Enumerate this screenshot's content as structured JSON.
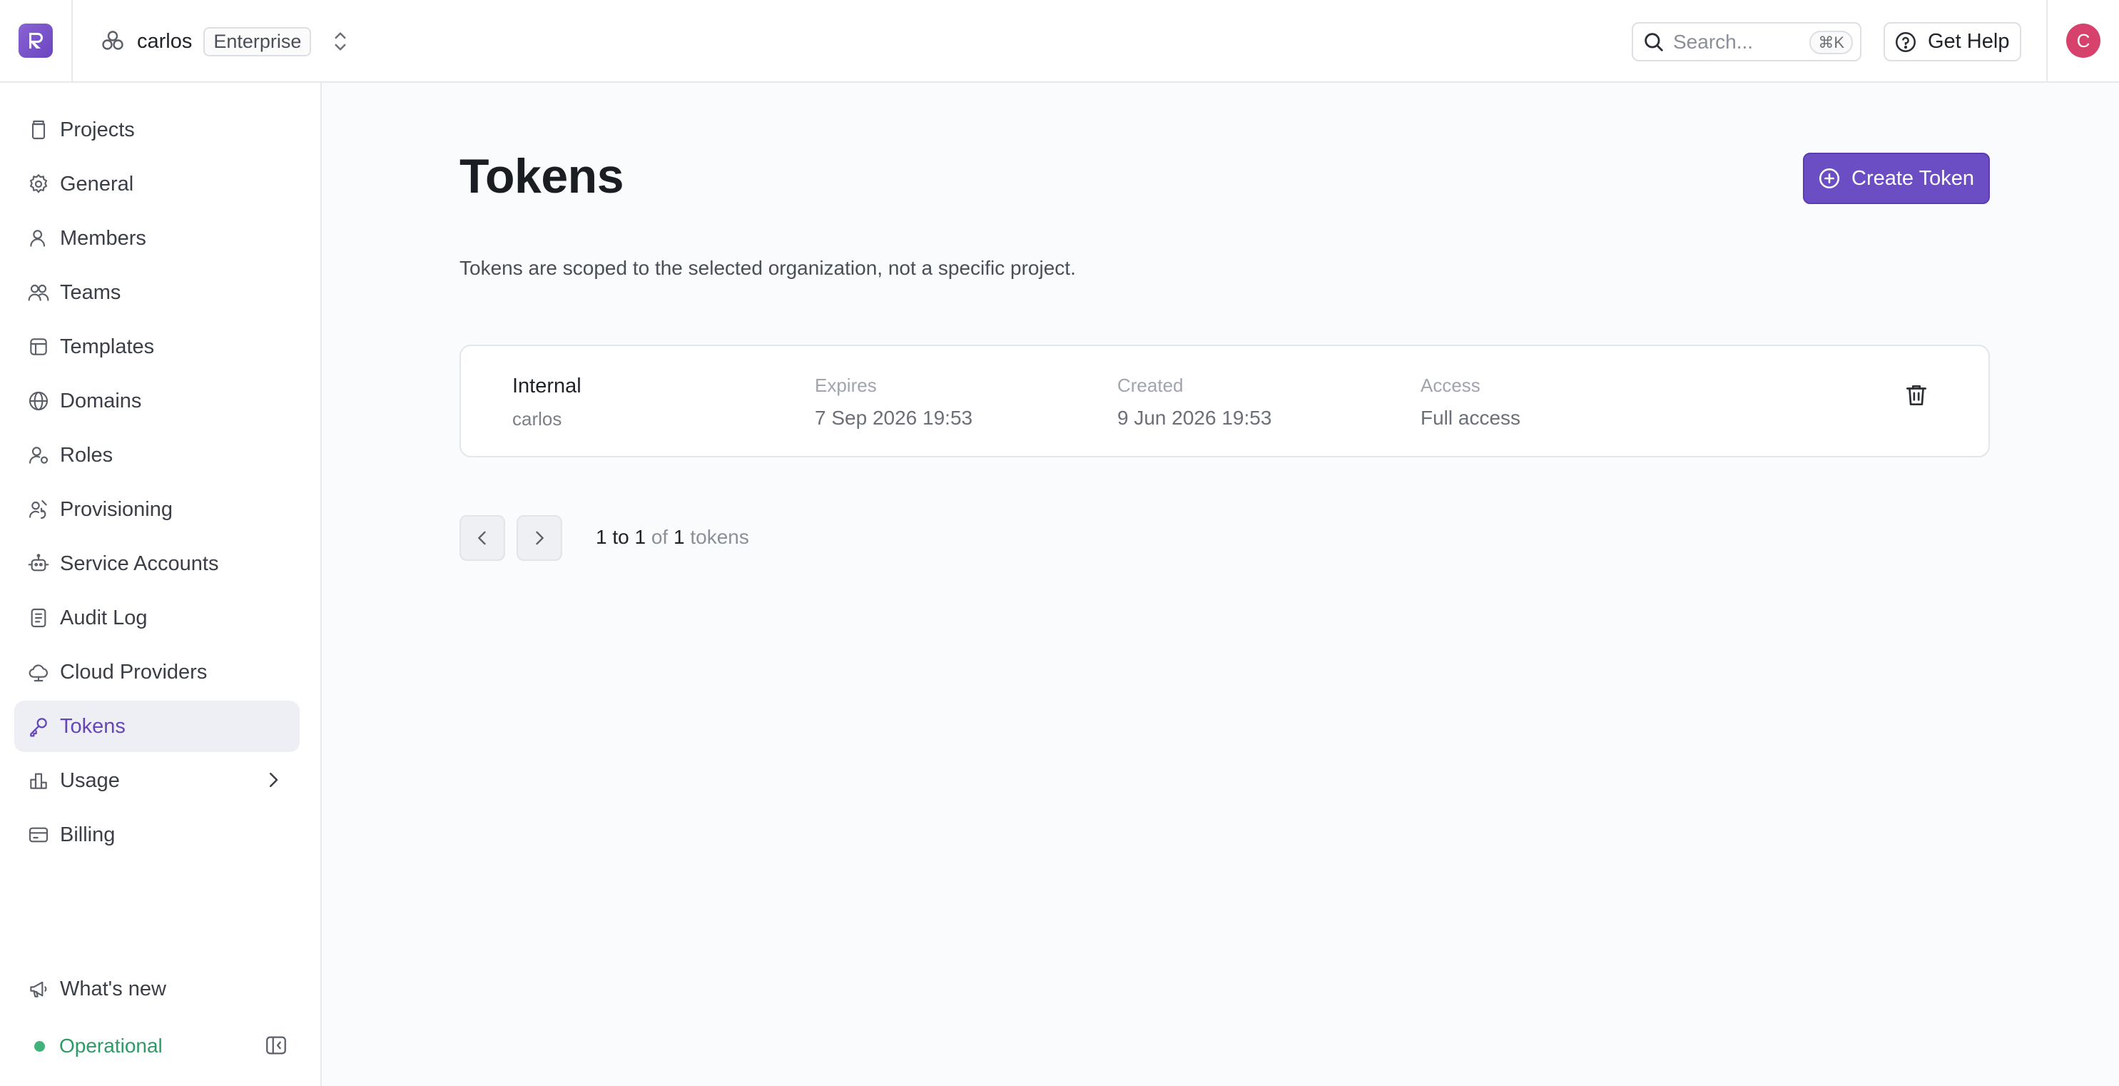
{
  "topbar": {
    "logo_letter": "R",
    "org_name": "carlos",
    "org_plan": "Enterprise",
    "search_placeholder": "Search...",
    "search_shortcut": "⌘K",
    "help_label": "Get Help",
    "avatar_initial": "C"
  },
  "sidebar": {
    "items": [
      {
        "label": "Projects",
        "icon": "projects-icon"
      },
      {
        "label": "General",
        "icon": "gear-icon"
      },
      {
        "label": "Members",
        "icon": "user-icon"
      },
      {
        "label": "Teams",
        "icon": "users-icon"
      },
      {
        "label": "Templates",
        "icon": "template-icon"
      },
      {
        "label": "Domains",
        "icon": "globe-icon"
      },
      {
        "label": "Roles",
        "icon": "user-key-icon"
      },
      {
        "label": "Provisioning",
        "icon": "provisioning-icon"
      },
      {
        "label": "Service Accounts",
        "icon": "bot-icon"
      },
      {
        "label": "Audit Log",
        "icon": "document-icon"
      },
      {
        "label": "Cloud Providers",
        "icon": "cloud-icon"
      },
      {
        "label": "Tokens",
        "icon": "key-icon",
        "active": true
      },
      {
        "label": "Usage",
        "icon": "bar-chart-icon",
        "has_chevron": true
      },
      {
        "label": "Billing",
        "icon": "credit-card-icon"
      }
    ],
    "whats_new": "What's new",
    "status": "Operational",
    "status_color": "#3fb37a"
  },
  "main": {
    "title": "Tokens",
    "create_button": "Create Token",
    "description": "Tokens are scoped to the selected organization, not a specific project.",
    "tokens": [
      {
        "name": "Internal",
        "owner": "carlos",
        "expires_label": "Expires",
        "expires": "7 Sep 2026 19:53",
        "created_label": "Created",
        "created": "9 Jun 2026 19:53",
        "access_label": "Access",
        "access": "Full access"
      }
    ],
    "pagination": {
      "from": "1",
      "to_word": "to",
      "to": "1",
      "of_word": "of",
      "total": "1",
      "unit": "tokens"
    }
  },
  "colors": {
    "accent": "#6b4dc4",
    "active_text": "#6546b8",
    "avatar": "#d6426c"
  }
}
